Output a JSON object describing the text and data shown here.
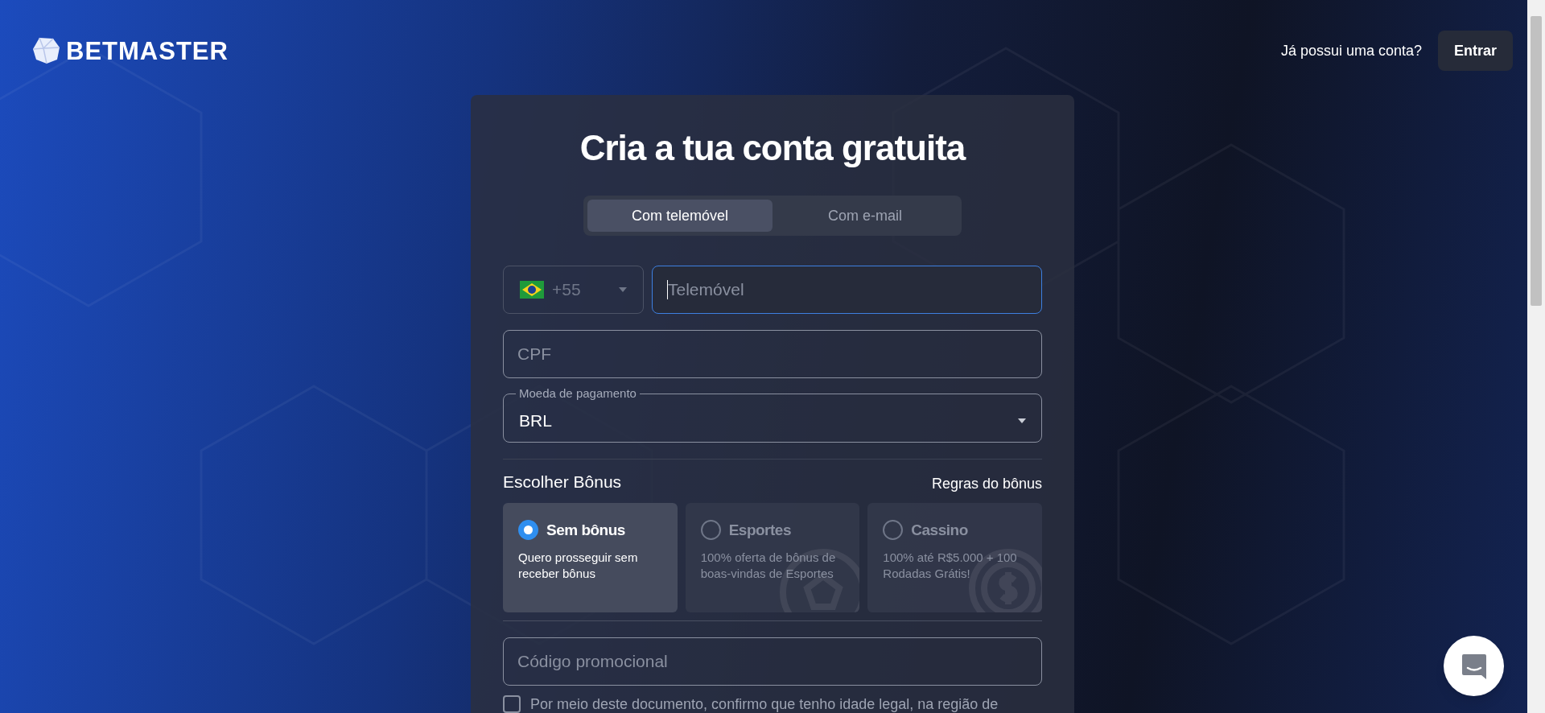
{
  "header": {
    "logo": "BETMASTER",
    "account_prompt": "Já possui uma conta?",
    "login_button": "Entrar"
  },
  "form": {
    "title": "Cria a tua conta gratuita",
    "tabs": [
      {
        "label": "Com telemóvel",
        "selected": true
      },
      {
        "label": "Com e-mail",
        "selected": false
      }
    ],
    "country_code": "+55",
    "phone": {
      "placeholder": "Telemóvel",
      "focused": true
    },
    "cpf": {
      "placeholder": "CPF"
    },
    "currency": {
      "label": "Moeda de pagamento",
      "value": "BRL"
    },
    "bonus_heading": "Escolher Bônus",
    "bonus_rules_link": "Regras do bônus",
    "bonus_options": [
      {
        "title": "Sem bônus",
        "description": "Quero prosseguir sem receber bônus",
        "selected": true
      },
      {
        "title": "Esportes",
        "description": "100% oferta de bônus de boas-vindas de Esportes",
        "selected": false
      },
      {
        "title": "Cassino",
        "description": "100% até R$5.000 + 100 Rodadas Grátis!",
        "selected": false
      }
    ],
    "promo_code": {
      "placeholder": "Código promocional"
    },
    "consent": {
      "text": "Por meio deste documento, confirmo que tenho idade legal, na região de",
      "checked": false
    }
  }
}
